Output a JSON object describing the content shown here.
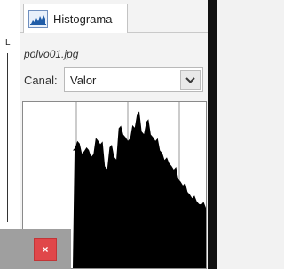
{
  "panel": {
    "tab_label": "Histograma",
    "filename": "polvo01.jpg",
    "channel_label": "Canal:",
    "channel_value": "Valor"
  },
  "icons": {
    "tab": "histogram-icon",
    "dropdown": "chevron-down-icon",
    "close": "close-icon"
  },
  "close_label": "×",
  "left_strip_mark": "L",
  "histogram": {
    "levels": [
      0.74,
      0.8,
      0.72,
      0.76,
      0.7,
      0.82,
      0.78,
      0.64,
      0.76,
      0.7,
      0.88,
      0.84,
      0.8,
      0.9,
      0.97,
      0.86,
      0.92,
      0.84,
      0.8,
      0.74,
      0.68,
      0.66,
      0.62,
      0.56,
      0.52,
      0.48,
      0.44,
      0.42,
      0.4,
      0.38
    ]
  },
  "colors": {
    "close": "#e0474a",
    "histogram_fill": "#000000"
  }
}
